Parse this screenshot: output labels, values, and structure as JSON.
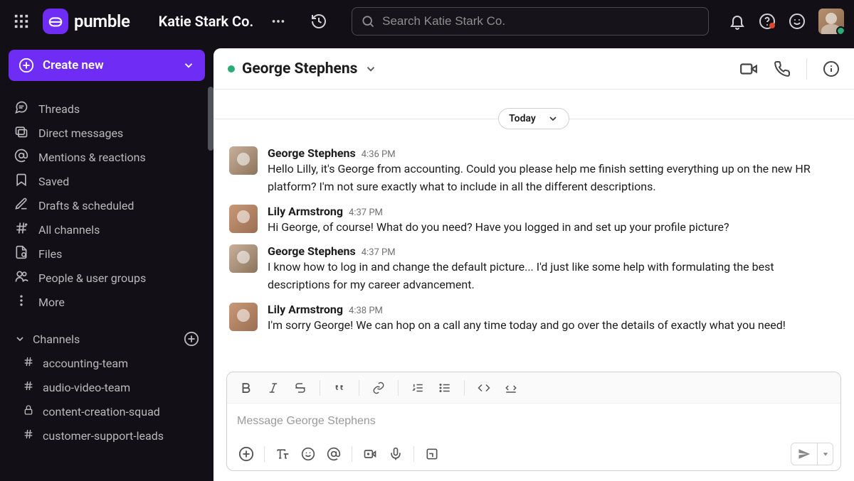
{
  "header": {
    "brand": "pumble",
    "workspace": "Katie Stark Co.",
    "search_placeholder": "Search Katie Stark Co."
  },
  "sidebar": {
    "create_label": "Create new",
    "nav": [
      {
        "label": "Threads"
      },
      {
        "label": "Direct messages"
      },
      {
        "label": "Mentions & reactions"
      },
      {
        "label": "Saved"
      },
      {
        "label": "Drafts & scheduled"
      },
      {
        "label": "All channels"
      },
      {
        "label": "Files"
      },
      {
        "label": "People & user groups"
      },
      {
        "label": "More"
      }
    ],
    "channels_header": "Channels",
    "channels": [
      {
        "label": "accounting-team",
        "locked": false
      },
      {
        "label": "audio-video-team",
        "locked": false
      },
      {
        "label": "content-creation-squad",
        "locked": true
      },
      {
        "label": "customer-support-leads",
        "locked": false
      }
    ]
  },
  "chat": {
    "title": "George Stephens",
    "date_label": "Today",
    "messages": [
      {
        "author": "George Stephens",
        "time": "4:36 PM",
        "avatar": "george",
        "text": "Hello Lilly, it's George from accounting. Could you please help me finish setting everything up on the new HR platform? I'm not sure exactly what to include in all the different descriptions."
      },
      {
        "author": "Lily Armstrong",
        "time": "4:37 PM",
        "avatar": "lily",
        "text": "Hi George, of course! What do you need? Have you logged in and set up your profile picture?"
      },
      {
        "author": "George Stephens",
        "time": "4:37 PM",
        "avatar": "george",
        "text": "I know how to log in and change the default picture... I'd just like some help with formulating the best descriptions for my career advancement."
      },
      {
        "author": "Lily Armstrong",
        "time": "4:38 PM",
        "avatar": "lily",
        "text": "I'm sorry George! We can hop on a call any time today and go over the details of exactly what you need!"
      }
    ],
    "composer_placeholder": "Message George Stephens"
  }
}
